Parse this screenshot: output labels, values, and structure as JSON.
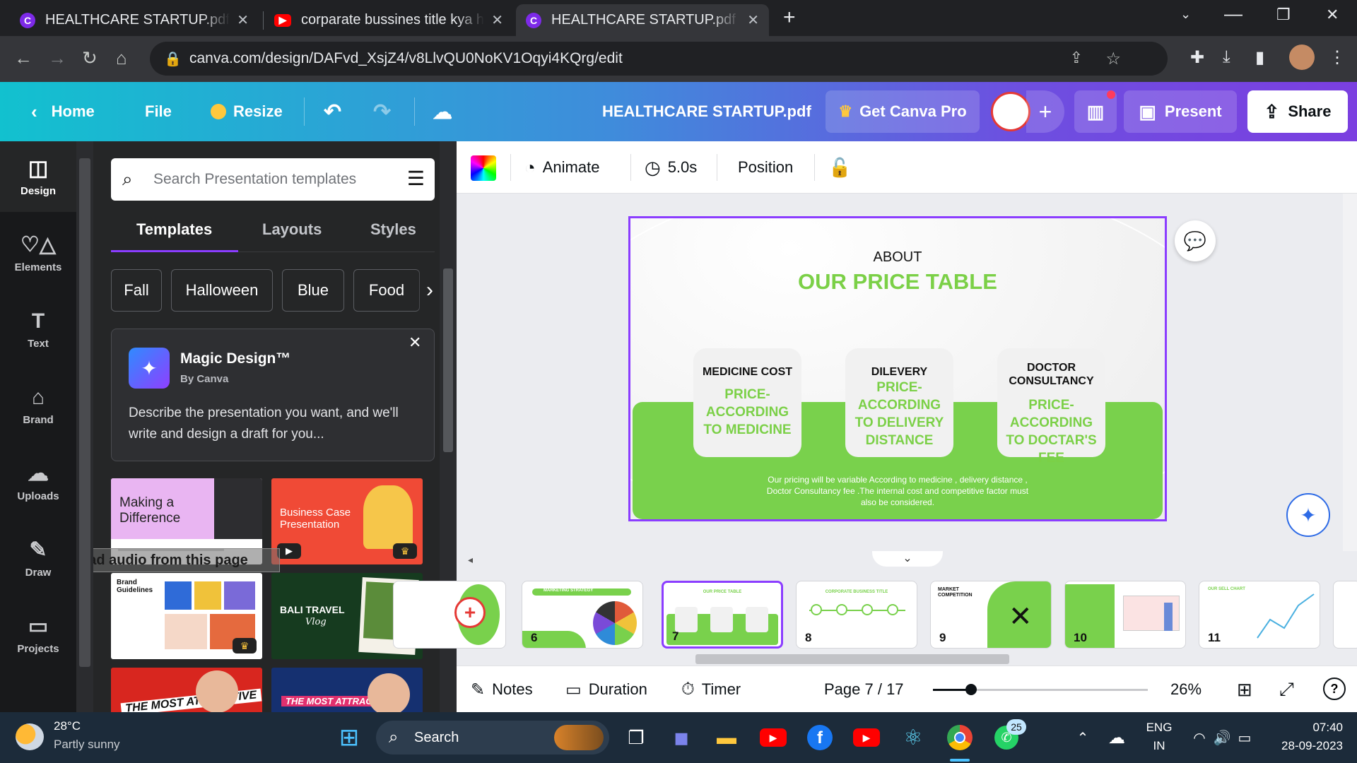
{
  "browser": {
    "tabs": [
      {
        "title": "HEALTHCARE STARTUP.pdf - Presentation",
        "icon": "canva-icon"
      },
      {
        "title": "corparate bussines title kya ha - YouTube",
        "icon": "youtube-icon"
      },
      {
        "title": "HEALTHCARE STARTUP.pdf - Presentation",
        "icon": "canva-icon"
      }
    ],
    "url": "canva.com/design/DAFvd_XsjZ4/v8LlvQU0NoKV1Oqyi4KQrg/edit"
  },
  "header": {
    "home": "Home",
    "file": "File",
    "resize": "Resize",
    "doc_title": "HEALTHCARE STARTUP.pdf",
    "get_pro": "Get Canva Pro",
    "present": "Present",
    "share": "Share"
  },
  "rail": {
    "items": [
      {
        "label": "Design",
        "icon": "layout-icon"
      },
      {
        "label": "Elements",
        "icon": "shapes-icon"
      },
      {
        "label": "Text",
        "icon": "text-icon"
      },
      {
        "label": "Brand",
        "icon": "brand-icon"
      },
      {
        "label": "Uploads",
        "icon": "cloud-upload-icon"
      },
      {
        "label": "Draw",
        "icon": "pen-icon"
      },
      {
        "label": "Projects",
        "icon": "folder-icon"
      }
    ]
  },
  "panel": {
    "search_placeholder": "Search Presentation templates",
    "tabs": [
      "Templates",
      "Layouts",
      "Styles"
    ],
    "chips": [
      "Fall",
      "Halloween",
      "Blue",
      "Food"
    ],
    "magic": {
      "title": "Magic Design™",
      "by": "By Canva",
      "desc": "Describe the presentation you want, and we'll write and design a draft for you..."
    },
    "templates": [
      {
        "title": "Making a Difference"
      },
      {
        "title": "Business Case Presentation"
      },
      {
        "title": "Brand Guidelines"
      },
      {
        "title": "BALI TRAVEL",
        "sub": "Vlog"
      },
      {
        "title": "THE MOST ATTRACTIVE"
      },
      {
        "title": "THE MOST ATTRACTIVE"
      }
    ],
    "download_overlay": "Download audio from this page"
  },
  "editor_toolbar": {
    "animate": "Animate",
    "duration": "5.0s",
    "position": "Position"
  },
  "slide": {
    "about": "ABOUT",
    "title": "OUR PRICE TABLE",
    "cards": [
      {
        "heading": "MEDICINE COST",
        "body": "PRICE-ACCORDING TO MEDICINE"
      },
      {
        "heading": "DILEVERY",
        "body": "PRICE-ACCORDING TO DELIVERY DISTANCE"
      },
      {
        "heading": "DOCTOR CONSULTANCY",
        "body": "PRICE-ACCORDING TO DOCTAR'S FEE"
      }
    ],
    "footer": "Our pricing  will be variable According to medicine , delivery distance , Doctor Consultancy fee .The internal cost and competitive factor must also be considered."
  },
  "filmstrip": {
    "pages": [
      {
        "num": "",
        "label": ""
      },
      {
        "num": "6",
        "label": "MARKETING STRATEGY"
      },
      {
        "num": "7",
        "label": "OUR PRICE TABLE"
      },
      {
        "num": "8",
        "label": "CORPORATE BUSINESS TITLE"
      },
      {
        "num": "9",
        "label": "MARKET COMPETITION"
      },
      {
        "num": "10",
        "label": ""
      },
      {
        "num": "11",
        "label": "OUR SELL CHART"
      }
    ]
  },
  "bottom": {
    "notes": "Notes",
    "duration": "Duration",
    "timer": "Timer",
    "page": "Page 7 / 17",
    "zoom_percent": 26,
    "zoom_label": "26%"
  },
  "taskbar": {
    "weather_temp": "28°C",
    "weather_desc": "Partly sunny",
    "search": "Search",
    "whatsapp_badge": "25",
    "lang1": "ENG",
    "lang2": "IN",
    "time": "07:40",
    "date": "28-09-2023"
  },
  "colors": {
    "accent_purple": "#8b3dff",
    "slide_green": "#79d14c",
    "taskbar": "#1c2b3a"
  }
}
